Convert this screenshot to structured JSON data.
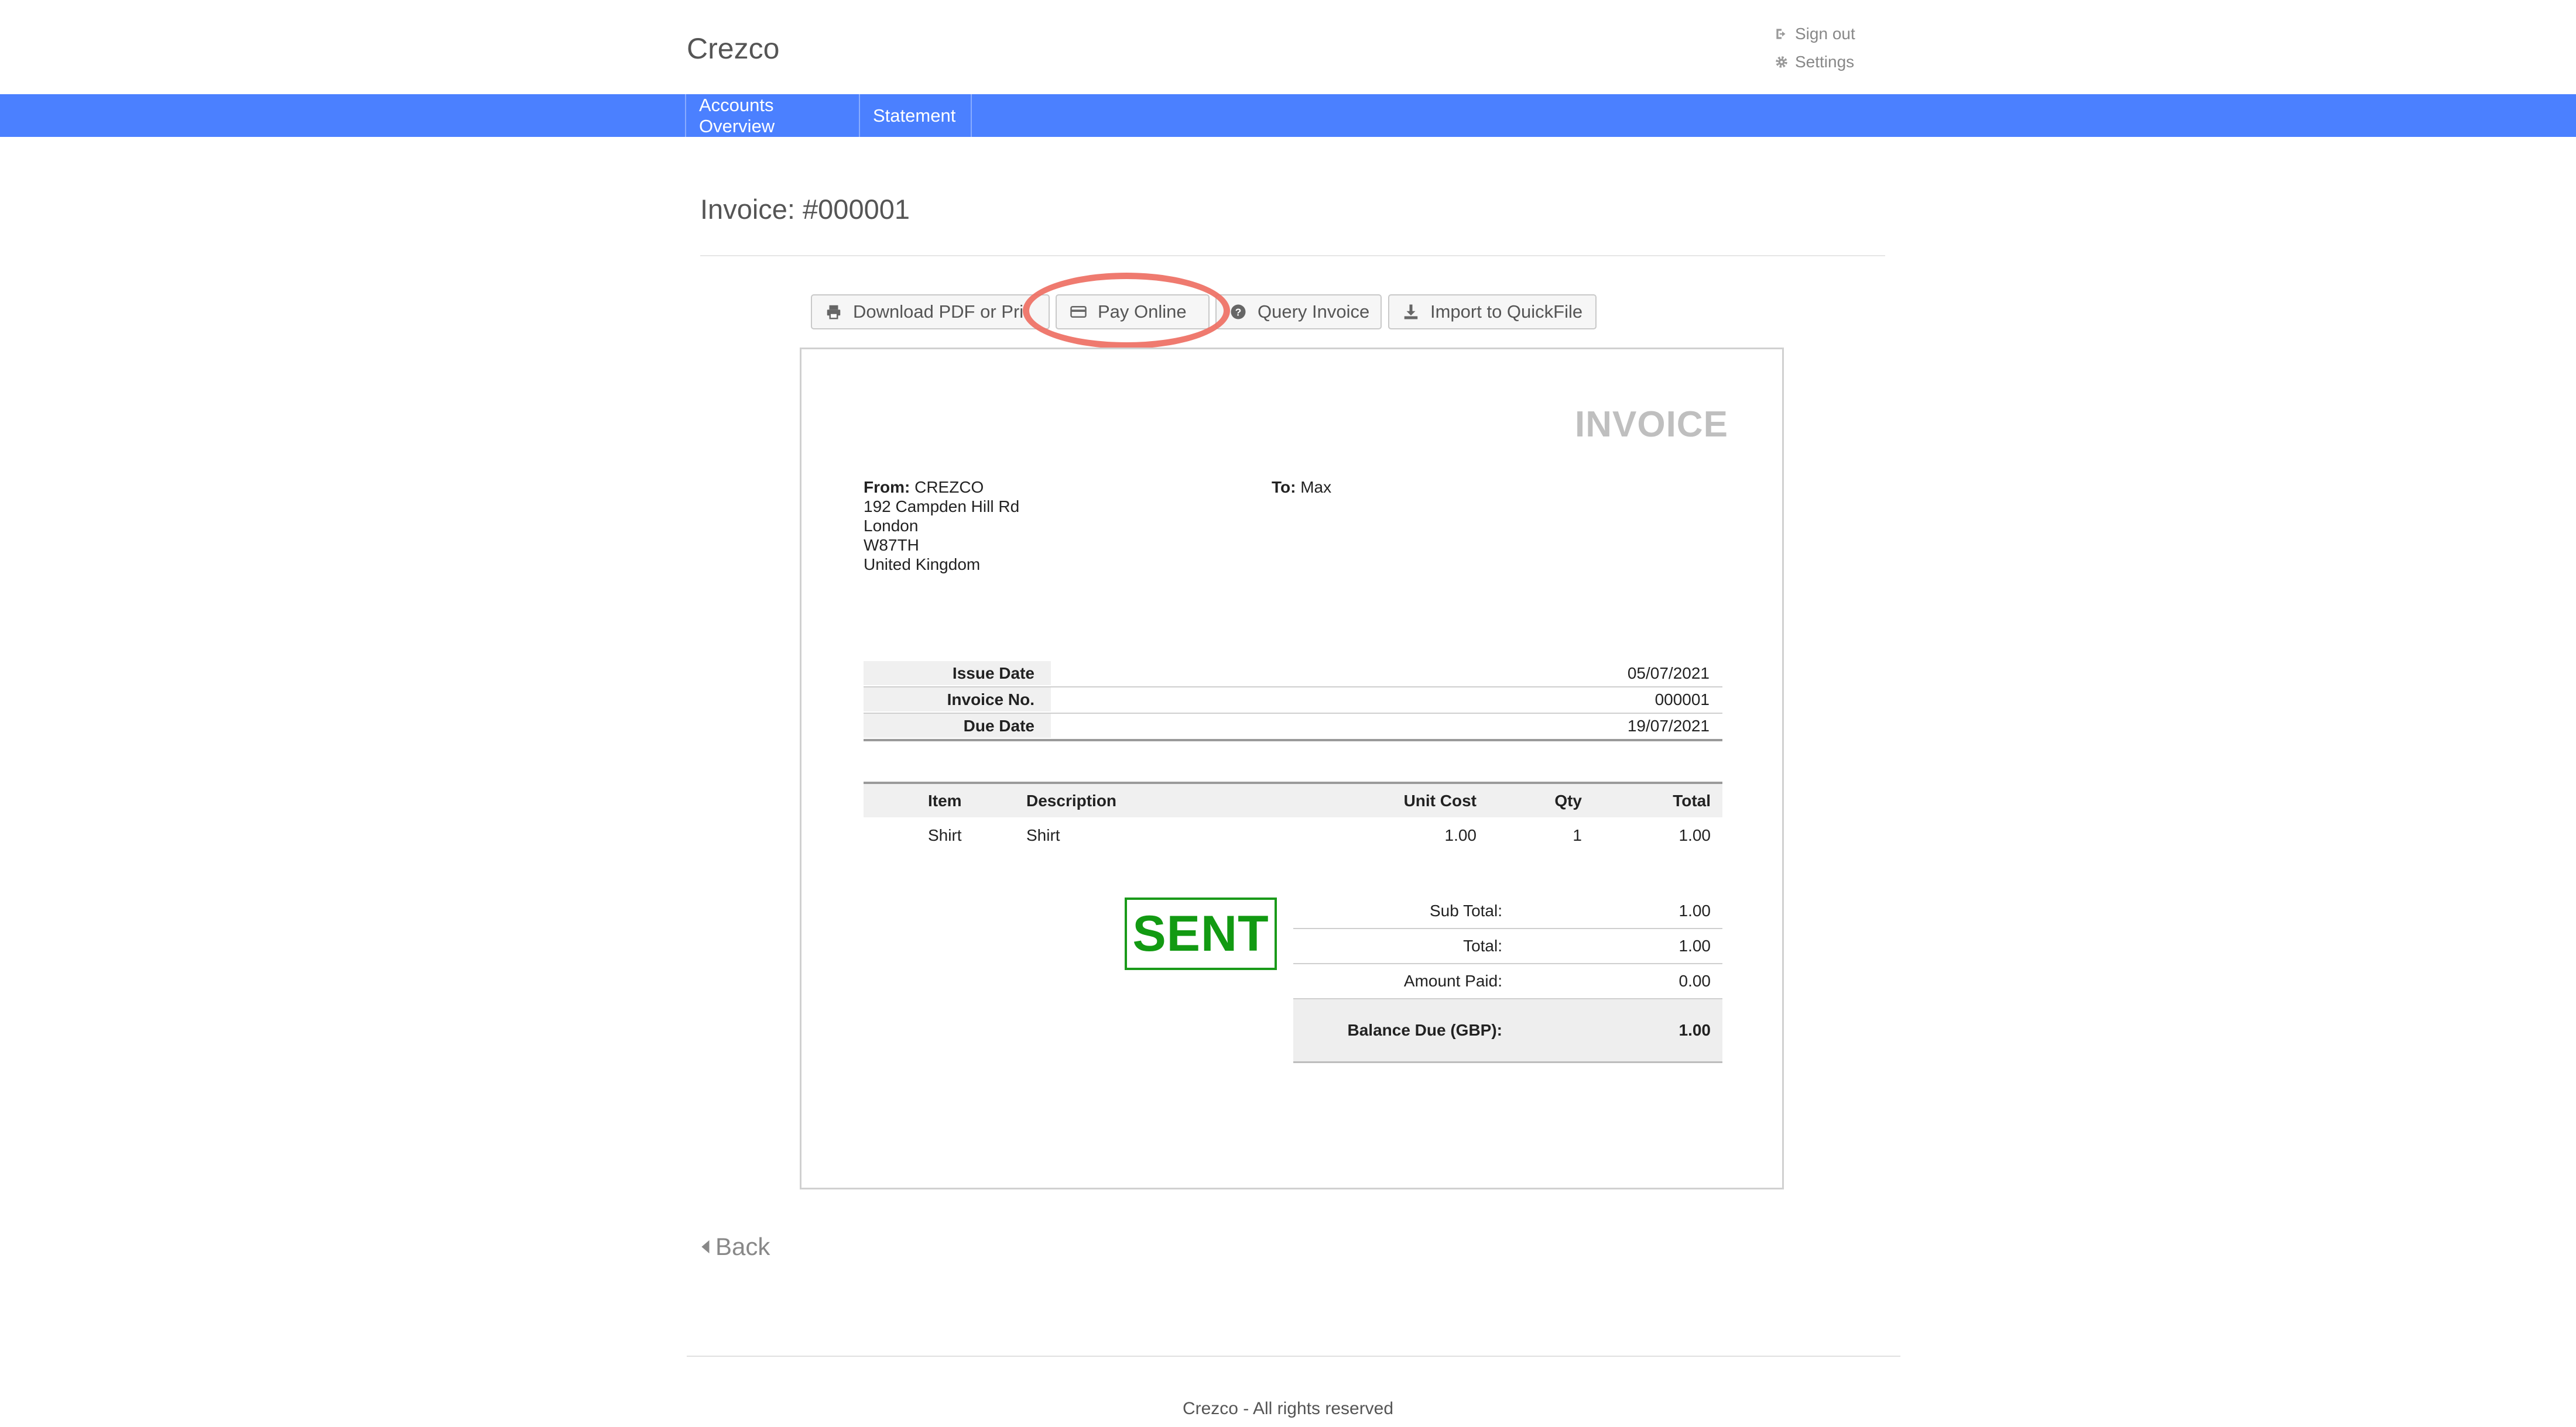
{
  "header": {
    "brand": "Crezco",
    "sign_out": "Sign out",
    "settings": "Settings"
  },
  "nav": {
    "items": [
      {
        "label": "Accounts Overview"
      },
      {
        "label": "Statement"
      }
    ],
    "color": "#4b80ff"
  },
  "page": {
    "title": "Invoice: #000001"
  },
  "toolbar": {
    "download": "Download PDF or Pri",
    "pay_online": "Pay Online",
    "query": "Query Invoice",
    "import": "Import to QuickFile"
  },
  "invoice": {
    "heading": "INVOICE",
    "from_label": "From:",
    "from_name": "CREZCO",
    "from_address": [
      "192 Campden Hill Rd",
      "London",
      "W87TH",
      "United Kingdom"
    ],
    "to_label": "To:",
    "to_name": "Max",
    "meta": [
      {
        "label": "Issue Date",
        "value": "05/07/2021"
      },
      {
        "label": "Invoice No.",
        "value": "000001"
      },
      {
        "label": "Due Date",
        "value": "19/07/2021"
      }
    ],
    "columns": {
      "item": "Item",
      "description": "Description",
      "unit_cost": "Unit Cost",
      "qty": "Qty",
      "total": "Total"
    },
    "rows": [
      {
        "item": "Shirt",
        "description": "Shirt",
        "unit_cost": "1.00",
        "qty": "1",
        "total": "1.00"
      }
    ],
    "status_stamp": "SENT",
    "totals": [
      {
        "label": "Sub Total:",
        "value": "1.00"
      },
      {
        "label": "Total:",
        "value": "1.00"
      },
      {
        "label": "Amount Paid:",
        "value": "0.00"
      },
      {
        "label": "Balance Due (GBP):",
        "value": "1.00"
      }
    ]
  },
  "back_label": "Back",
  "footer": {
    "text": "Crezco - All rights reserved"
  }
}
